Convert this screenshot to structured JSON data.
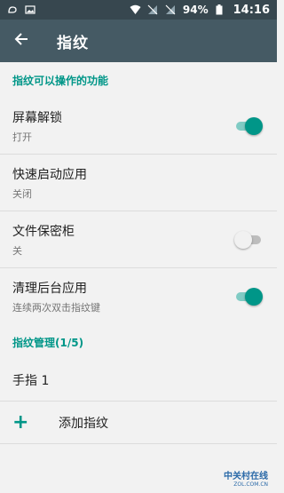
{
  "status_bar": {
    "battery": "94%",
    "time": "14:16"
  },
  "app_bar": {
    "title": "指纹"
  },
  "section_features": {
    "header": "指纹可以操作的功能",
    "items": [
      {
        "title": "屏幕解锁",
        "subtitle": "打开",
        "toggle": "on"
      },
      {
        "title": "快速启动应用",
        "subtitle": "关闭",
        "toggle": null
      },
      {
        "title": "文件保密柜",
        "subtitle": "关",
        "toggle": "off"
      },
      {
        "title": "清理后台应用",
        "subtitle": "连续两次双击指纹键",
        "toggle": "on"
      }
    ]
  },
  "section_manage": {
    "header": "指纹管理(1/5)",
    "finger": "手指 1",
    "add_label": "添加指纹",
    "add_icon": "+"
  },
  "watermark": {
    "main": "中关村在线",
    "sub": "ZOL.COM.CN"
  },
  "colors": {
    "accent": "#009688",
    "app_bar": "#455a64",
    "status_bar": "#37474f"
  }
}
